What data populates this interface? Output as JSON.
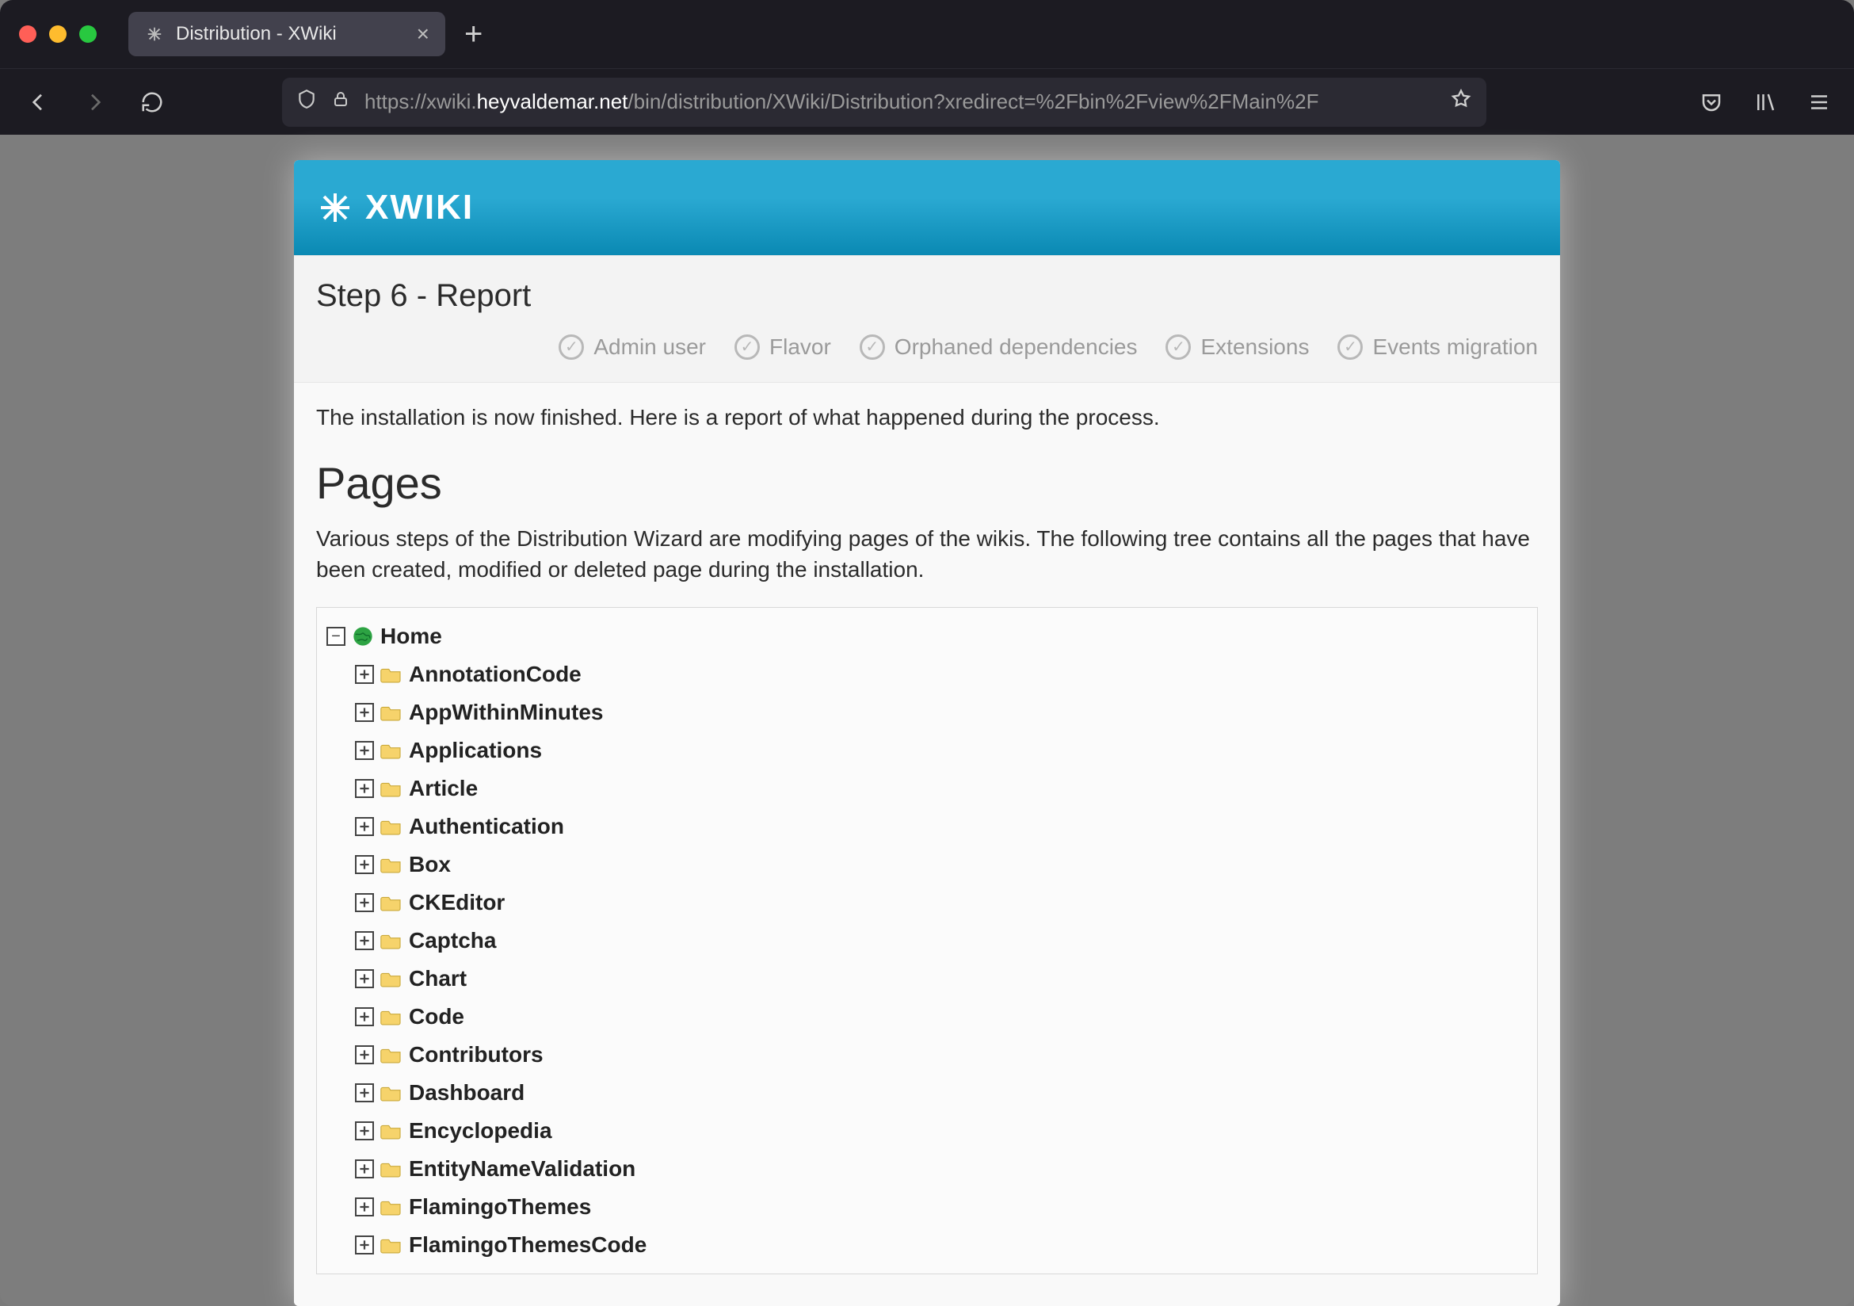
{
  "browser": {
    "tab_title": "Distribution - XWiki",
    "url_dim_prefix": "https://xwiki.",
    "url_bright_host": "heyvaldemar.net",
    "url_dim_suffix": "/bin/distribution/XWiki/Distribution?xredirect=%2Fbin%2Fview%2FMain%2F"
  },
  "header": {
    "logo_text": "XWIKI"
  },
  "wizard": {
    "step_title": "Step 6 - Report",
    "steps": [
      "Admin user",
      "Flavor",
      "Orphaned dependencies",
      "Extensions",
      "Events migration"
    ]
  },
  "content": {
    "intro": "The installation is now finished. Here is a report of what happened during the process.",
    "pages_heading": "Pages",
    "pages_desc": "Various steps of the Distribution Wizard are modifying pages of the wikis. The following tree contains all the pages that have been created, modified or deleted page during the installation."
  },
  "tree": {
    "root": {
      "label": "Home",
      "expanded": true
    },
    "items": [
      {
        "label": "AnnotationCode"
      },
      {
        "label": "AppWithinMinutes"
      },
      {
        "label": "Applications"
      },
      {
        "label": "Article"
      },
      {
        "label": "Authentication"
      },
      {
        "label": "Box"
      },
      {
        "label": "CKEditor"
      },
      {
        "label": "Captcha"
      },
      {
        "label": "Chart"
      },
      {
        "label": "Code"
      },
      {
        "label": "Contributors"
      },
      {
        "label": "Dashboard"
      },
      {
        "label": "Encyclopedia"
      },
      {
        "label": "EntityNameValidation"
      },
      {
        "label": "FlamingoThemes"
      },
      {
        "label": "FlamingoThemesCode"
      }
    ]
  }
}
